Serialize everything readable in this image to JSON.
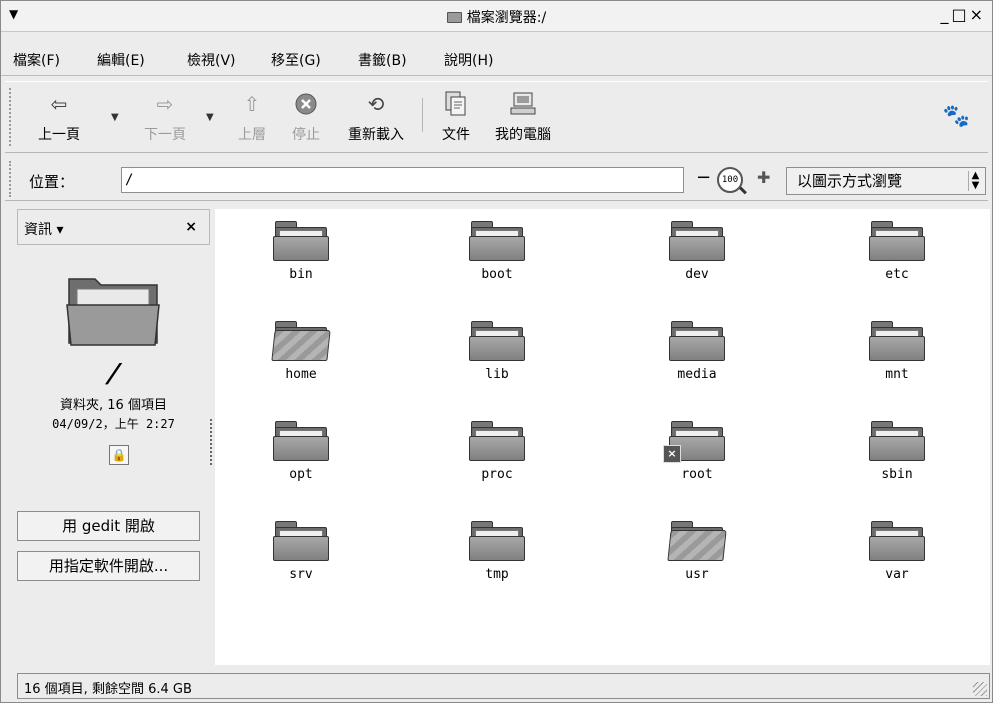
{
  "window": {
    "title": "檔案瀏覽器:/",
    "controls": [
      "_",
      "□",
      "×"
    ]
  },
  "menubar": {
    "items": [
      {
        "label": "檔案(F)"
      },
      {
        "label": "編輯(E)"
      },
      {
        "label": "檢視(V)"
      },
      {
        "label": "移至(G)"
      },
      {
        "label": "書籤(B)"
      },
      {
        "label": "說明(H)"
      }
    ]
  },
  "toolbar": {
    "back": "上一頁",
    "forward": "下一頁",
    "up": "上層",
    "stop": "停止",
    "reload": "重新載入",
    "documents": "文件",
    "computer": "我的電腦"
  },
  "location": {
    "label": "位置：",
    "value": "/",
    "zoom": "100",
    "view_mode": "以圖示方式瀏覽"
  },
  "sidebar": {
    "title": "資訊 ▾",
    "close": "×",
    "path": "/",
    "summary": "資料夾, 16 個項目",
    "modified": "04/09/2，上午 2:27",
    "open_with_gedit": "用 gedit 開啟",
    "open_with_other": "用指定軟件開啟..."
  },
  "files": [
    {
      "name": "bin",
      "style": "normal"
    },
    {
      "name": "boot",
      "style": "normal"
    },
    {
      "name": "dev",
      "style": "normal"
    },
    {
      "name": "etc",
      "style": "normal"
    },
    {
      "name": "home",
      "style": "special"
    },
    {
      "name": "lib",
      "style": "normal"
    },
    {
      "name": "media",
      "style": "normal"
    },
    {
      "name": "mnt",
      "style": "normal"
    },
    {
      "name": "opt",
      "style": "normal"
    },
    {
      "name": "proc",
      "style": "normal"
    },
    {
      "name": "root",
      "style": "locked"
    },
    {
      "name": "sbin",
      "style": "normal"
    },
    {
      "name": "srv",
      "style": "normal"
    },
    {
      "name": "tmp",
      "style": "normal"
    },
    {
      "name": "usr",
      "style": "special"
    },
    {
      "name": "var",
      "style": "normal"
    }
  ],
  "statusbar": {
    "text": "16 個項目, 剩餘空間 6.4 GB"
  }
}
